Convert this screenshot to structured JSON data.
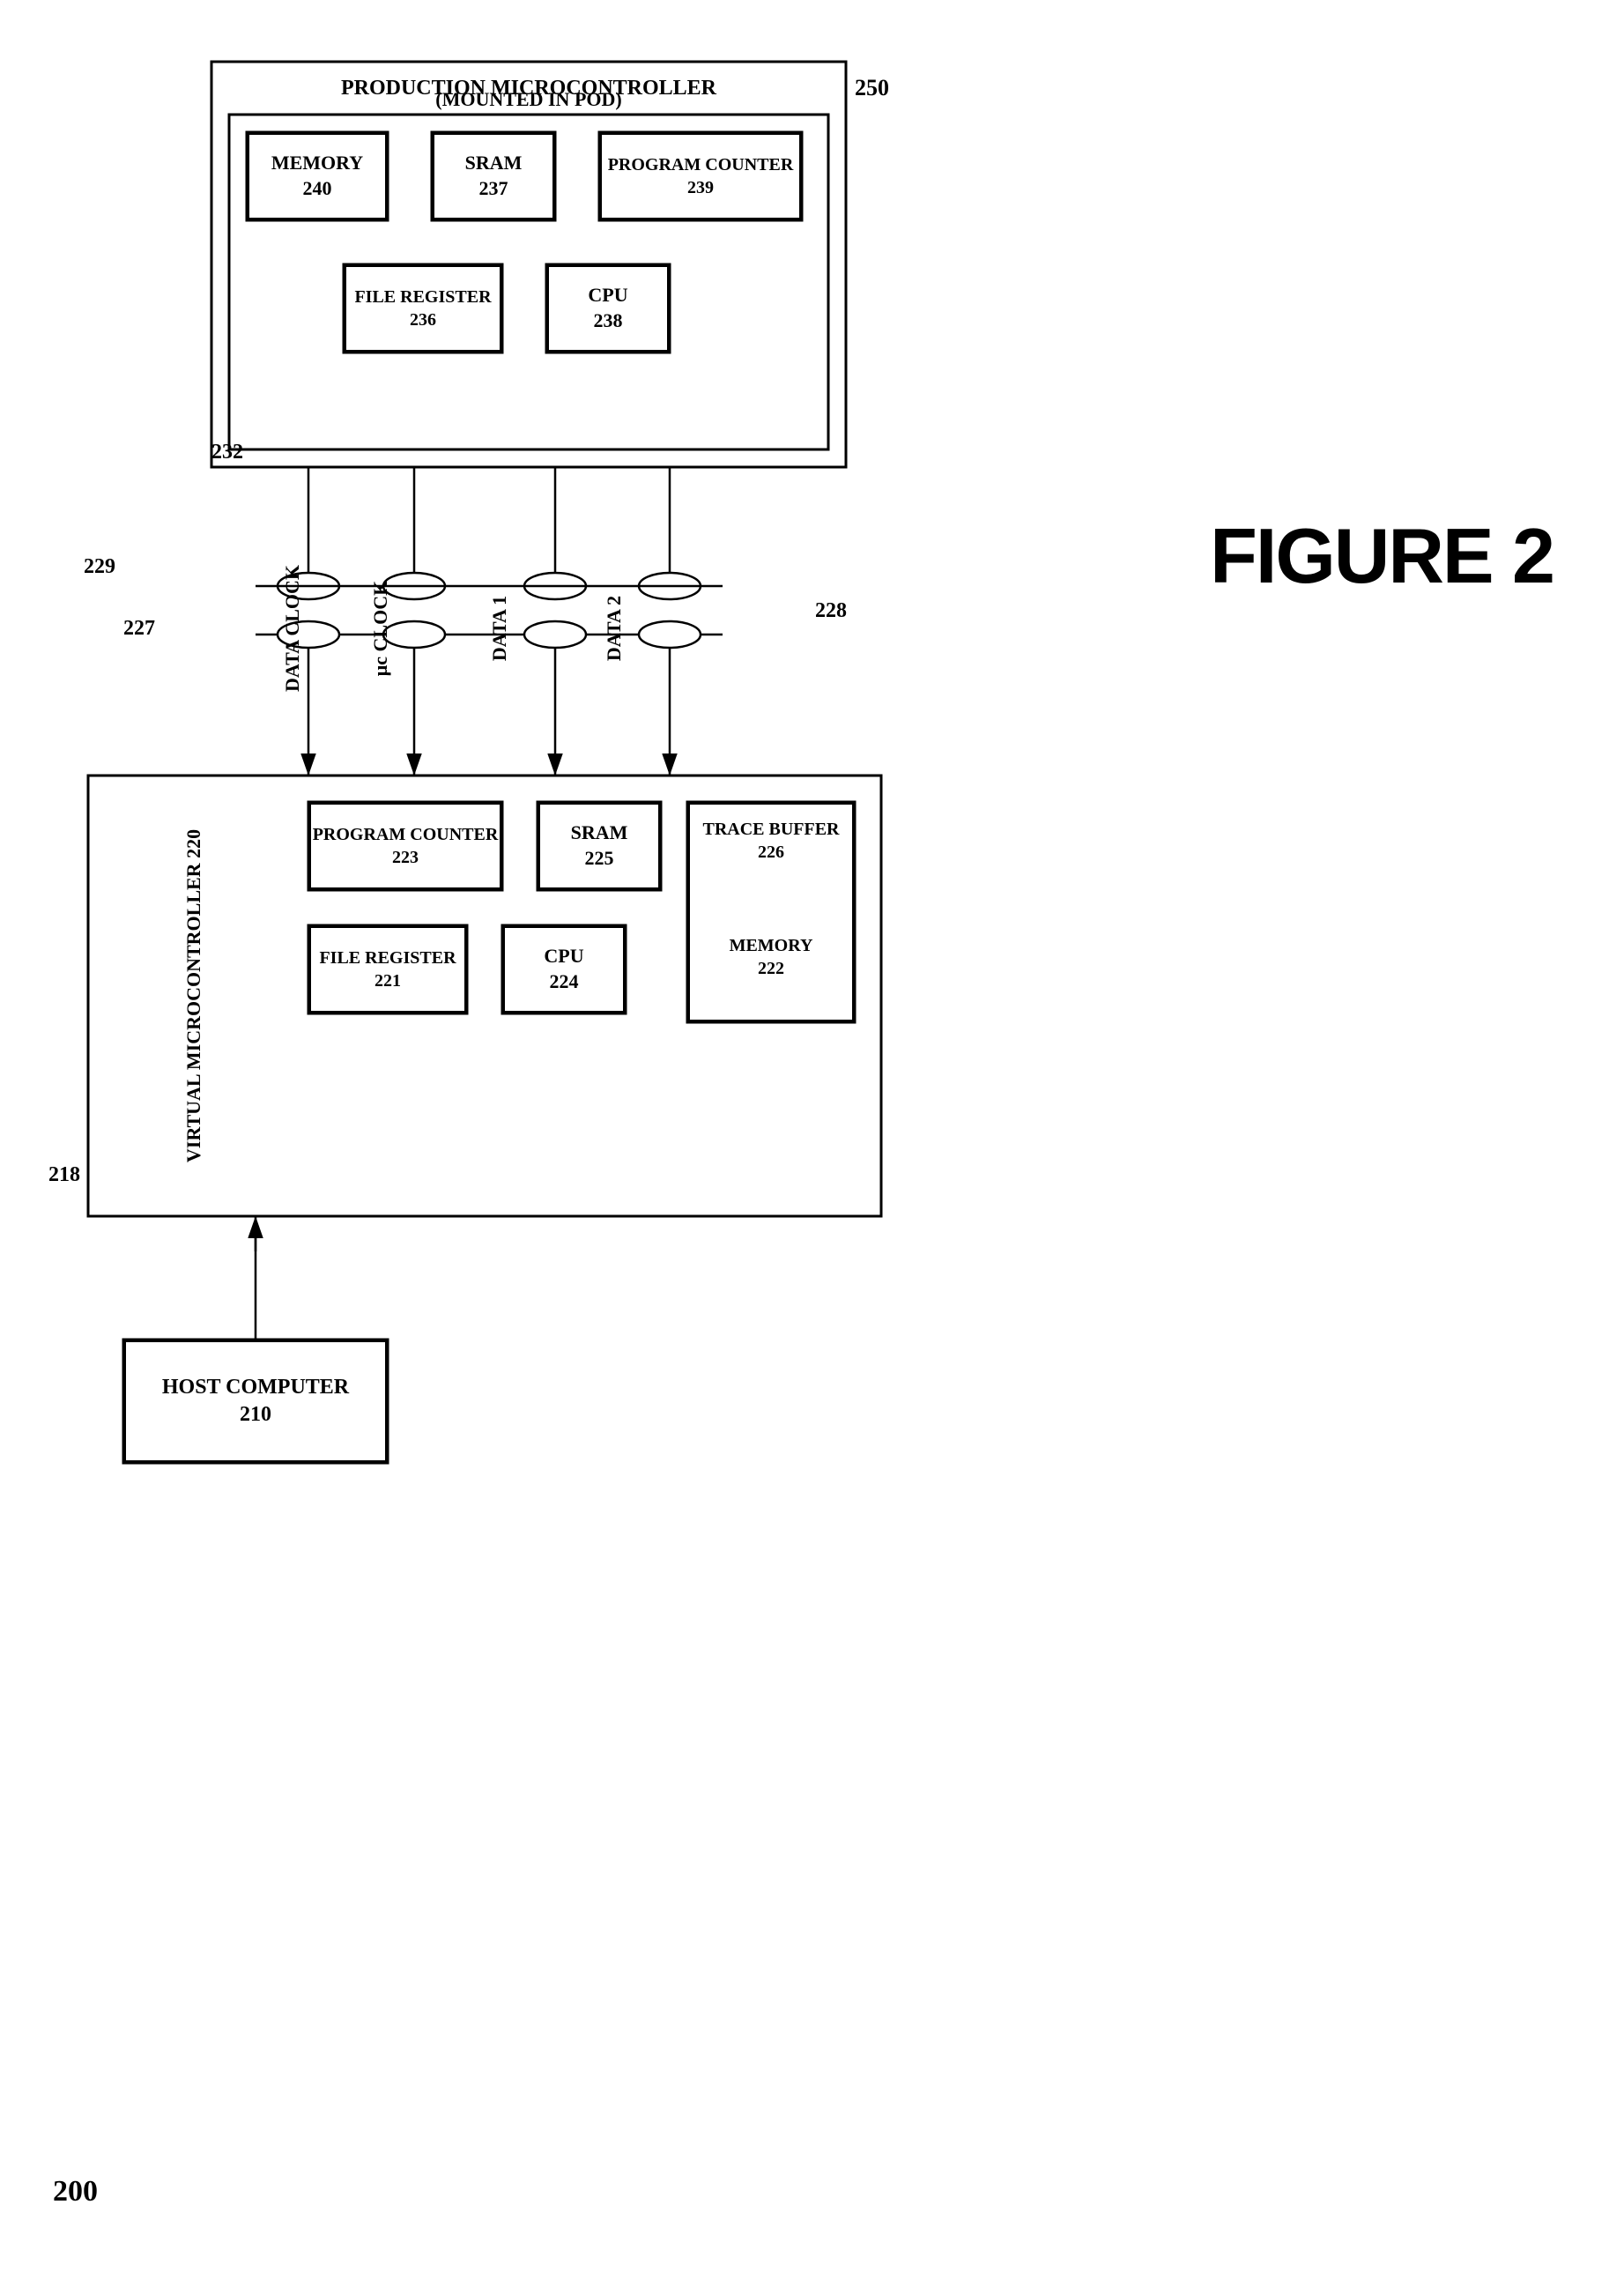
{
  "figure": {
    "label": "FIGURE 2",
    "page_number": "200"
  },
  "production_microcontroller": {
    "title_line1": "PRODUCTION MICROCONTROLLER",
    "title_line2": "(MOUNTED IN POD)",
    "ref": "250",
    "inner_box_ref": "232",
    "memory": {
      "label": "MEMORY",
      "ref": "240"
    },
    "sram": {
      "label": "SRAM",
      "ref": "237"
    },
    "program_counter": {
      "label": "PROGRAM COUNTER",
      "ref": "239"
    },
    "file_register": {
      "label": "FILE REGISTER",
      "ref": "236"
    },
    "cpu": {
      "label": "CPU",
      "ref": "238"
    }
  },
  "virtual_microcontroller": {
    "title": "VIRTUAL MICROCONTROLLER",
    "ref": "220",
    "program_counter": {
      "label": "PROGRAM COUNTER",
      "ref": "223"
    },
    "sram": {
      "label": "SRAM",
      "ref": "225"
    },
    "trace_buffer": {
      "label": "TRACE BUFFER",
      "ref": "226"
    },
    "memory": {
      "label": "MEMORY",
      "ref": "222"
    },
    "file_register": {
      "label": "FILE REGISTER",
      "ref": "221"
    },
    "cpu": {
      "label": "CPU",
      "ref": "224"
    }
  },
  "host_computer": {
    "label": "HOST COMPUTER",
    "ref": "210"
  },
  "bus_labels": {
    "data_clock": "DATA CLOCK",
    "uc_clock": "μc CLOCK",
    "data1": "DATA 1",
    "data2": "DATA 2",
    "ref_227": "227",
    "ref_229": "229",
    "ref_228": "228",
    "ref_218": "218"
  }
}
